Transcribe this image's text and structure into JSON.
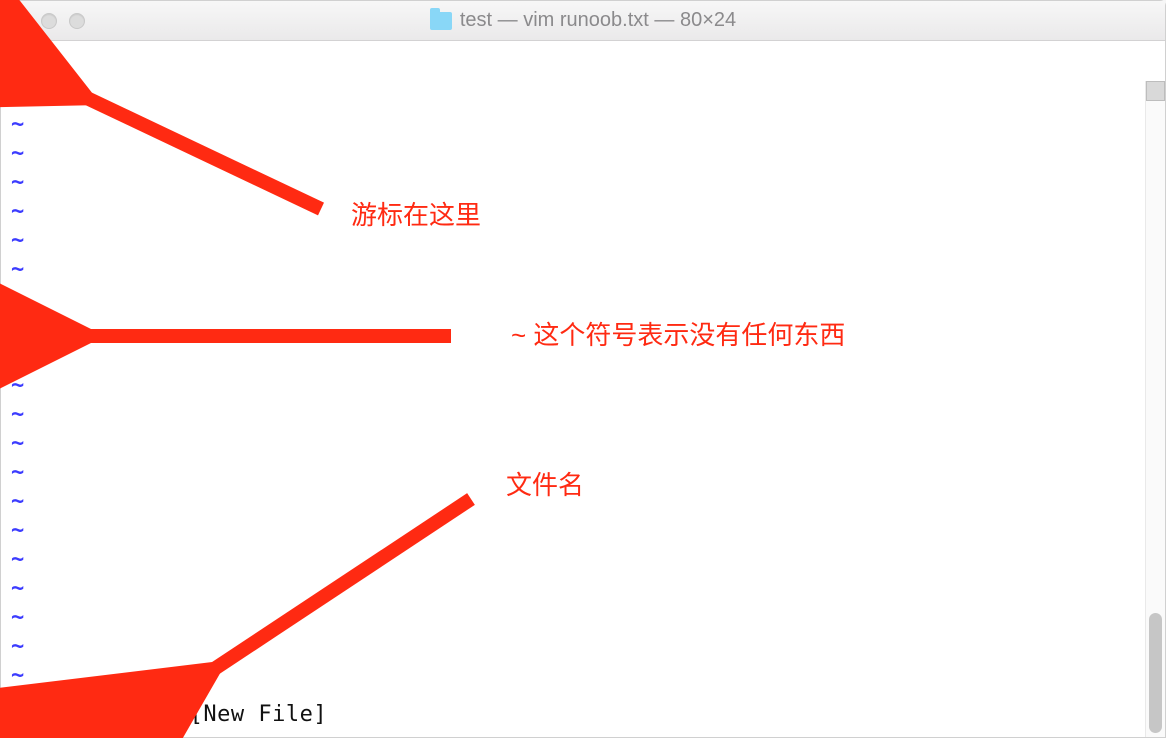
{
  "titlebar": {
    "title": "test — vim runoob.txt — 80×24"
  },
  "editor": {
    "tilde_char": "~",
    "tilde_count": 22,
    "status_line": "\"runoob.txt\" [New File]"
  },
  "annotations": {
    "cursor_label": "游标在这里",
    "tilde_label": "~ 这个符号表示没有任何东西",
    "filename_label": "文件名"
  },
  "colors": {
    "annotation_red": "#ff2a12",
    "tilde_blue": "#3b3bff"
  }
}
